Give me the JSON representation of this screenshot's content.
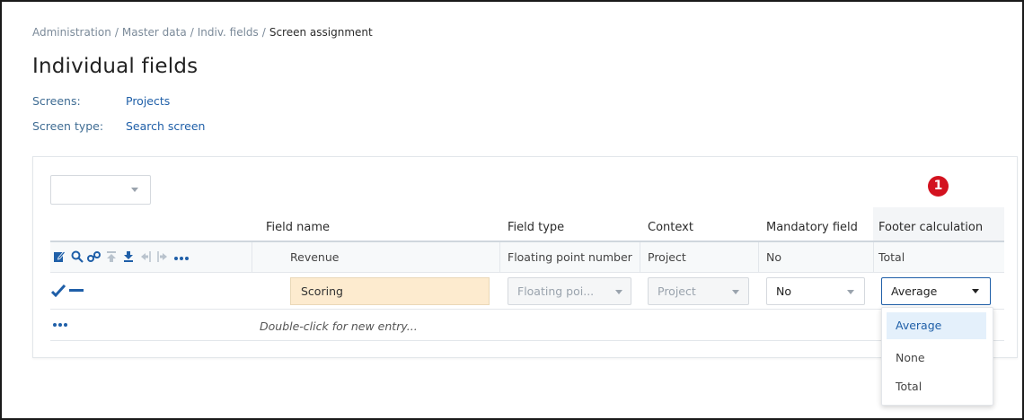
{
  "breadcrumb": {
    "items": [
      "Administration",
      "Master data",
      "Indiv. fields"
    ],
    "separator": "/",
    "current": "Screen assignment"
  },
  "page_title": "Individual fields",
  "meta": [
    {
      "key": "Screens:",
      "value": "Projects"
    },
    {
      "key": "Screen type:",
      "value": "Search screen"
    }
  ],
  "annotation_badge": "1",
  "table": {
    "columns": [
      "Field name",
      "Field type",
      "Context",
      "Mandatory field",
      "Footer calculation"
    ],
    "rows": [
      {
        "field_name": "Revenue",
        "field_type": "Floating point number",
        "context": "Project",
        "mandatory": "No",
        "footer": "Total"
      }
    ],
    "edit_row": {
      "field_name": "Scoring",
      "field_type": "Floating poi...",
      "context": "Project",
      "mandatory": "No",
      "footer": "Average"
    },
    "new_entry_hint": "Double-click for new entry...",
    "more_label": "..."
  },
  "footer_dropdown": {
    "options": [
      "Average",
      "None",
      "Total"
    ],
    "selected": "Average"
  },
  "colors": {
    "accent": "#1f5fa8",
    "badge": "#d3121f",
    "edit_highlight": "#fdebcf",
    "selected_option": "#e4f0fb"
  },
  "icons": [
    "edit-icon",
    "search-icon",
    "link-icon",
    "move-up-icon",
    "move-down-icon",
    "indent-left-icon",
    "indent-right-icon",
    "more-icon",
    "confirm-check-icon",
    "cancel-dash-icon"
  ]
}
